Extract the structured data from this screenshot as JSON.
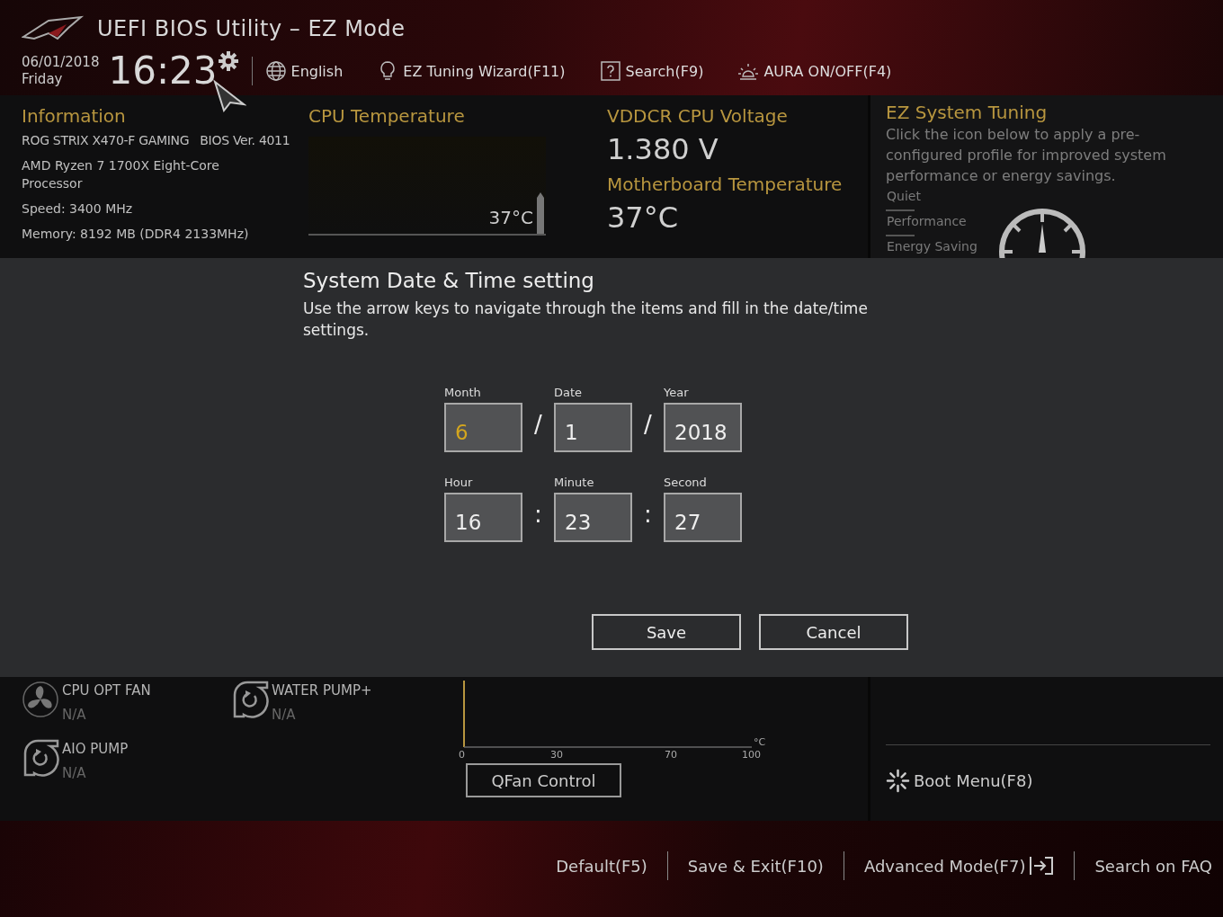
{
  "window": {
    "title": "UEFI BIOS Utility – EZ Mode"
  },
  "header": {
    "date": "06/01/2018",
    "day": "Friday",
    "time": "16:23",
    "toolbar": [
      {
        "kind": "language",
        "label": "English"
      },
      {
        "kind": "wizard",
        "label": "EZ Tuning Wizard(F11)"
      },
      {
        "kind": "search",
        "label": "Search(F9)"
      },
      {
        "kind": "aura",
        "label": "AURA ON/OFF(F4)"
      }
    ]
  },
  "information": {
    "title": "Information",
    "lines": [
      [
        "ROG STRIX X470-F GAMING",
        "BIOS Ver. 4011"
      ],
      [
        "AMD Ryzen 7 1700X Eight-Core Processor"
      ],
      [
        "Speed: 3400 MHz"
      ],
      [
        "Memory: 8192 MB (DDR4 2133MHz)"
      ]
    ]
  },
  "cpu_temperature": {
    "title": "CPU Temperature",
    "reading": "37°C"
  },
  "readings": [
    {
      "title": "VDDCR CPU Voltage",
      "value": "1.380 V"
    },
    {
      "title": "Motherboard Temperature",
      "value": "37°C"
    }
  ],
  "ez_system_tuning": {
    "title": "EZ System Tuning",
    "description": "Click the icon below to apply a pre-configured profile for improved system performance or energy savings.",
    "profiles": [
      "Quiet",
      "Performance",
      "Energy Saving"
    ]
  },
  "dialog": {
    "title": "System Date & Time setting",
    "description": "Use the arrow keys to navigate through the items and fill in the date/time settings.",
    "rows": [
      {
        "fields": [
          {
            "label": "Month",
            "value": "6",
            "selected": true,
            "after": "/"
          },
          {
            "label": "Date",
            "value": "1",
            "selected": false,
            "after": "/"
          },
          {
            "label": "Year",
            "value": "2018",
            "selected": false
          }
        ]
      },
      {
        "fields": [
          {
            "label": "Hour",
            "value": "16",
            "selected": false,
            "after": ":"
          },
          {
            "label": "Minute",
            "value": "23",
            "selected": false,
            "after": ":"
          },
          {
            "label": "Second",
            "value": "27",
            "selected": false
          }
        ]
      }
    ],
    "buttons": [
      "Save",
      "Cancel"
    ]
  },
  "fans": [
    {
      "kind": "fan",
      "name": "CPU OPT FAN",
      "reading": "N/A"
    },
    {
      "kind": "pump",
      "name": "WATER PUMP+",
      "reading": "N/A"
    },
    {
      "kind": "pump",
      "name": "AIO PUMP",
      "reading": "N/A"
    }
  ],
  "fan_graph": {
    "xticks": [
      "0",
      "30",
      "70",
      "100"
    ],
    "unit": "°C"
  },
  "qfan_button": "QFan Control",
  "boot_menu": "Boot Menu(F8)",
  "footer": [
    {
      "kind": "text",
      "label": "Default(F5)"
    },
    {
      "kind": "text",
      "label": "Save & Exit(F10)"
    },
    {
      "kind": "exit",
      "label": "Advanced Mode(F7)"
    },
    {
      "kind": "text",
      "label": "Search on FAQ"
    }
  ]
}
